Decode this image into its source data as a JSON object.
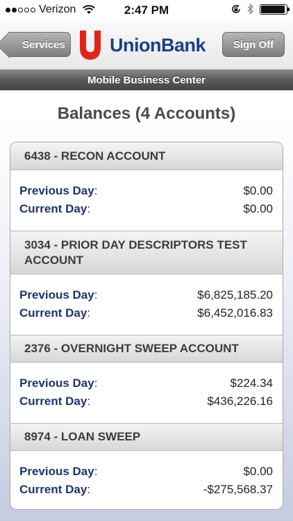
{
  "status_bar": {
    "carrier": "Verizon",
    "signal_filled": 2,
    "signal_total": 5,
    "time": "2:47 PM",
    "battery_level": 0.95,
    "icons": [
      "wifi-icon",
      "rotation-lock-icon",
      "bluetooth-icon",
      "battery-icon"
    ]
  },
  "header": {
    "back_label": "Services",
    "logo_text": "UnionBank",
    "signoff_label": "Sign Off",
    "brand_color": "#1d3e88",
    "logo_color": "#e2231a"
  },
  "subheader": {
    "title": "Mobile Business Center"
  },
  "page": {
    "title": "Balances (4 Accounts)"
  },
  "accounts": [
    {
      "name": "6438 - RECON ACCOUNT",
      "previous_label": "Previous Day",
      "previous_value": "$0.00",
      "current_label": "Current Day",
      "current_value": "$0.00"
    },
    {
      "name": "3034 - PRIOR DAY DESCRIPTORS TEST ACCOUNT",
      "previous_label": "Previous Day",
      "previous_value": "$6,825,185.20",
      "current_label": "Current Day",
      "current_value": "$6,452,016.83"
    },
    {
      "name": "2376 - OVERNIGHT SWEEP ACCOUNT",
      "previous_label": "Previous Day",
      "previous_value": "$224.34",
      "current_label": "Current Day",
      "current_value": "$436,226.16"
    },
    {
      "name": "8974 - LOAN SWEEP",
      "previous_label": "Previous Day",
      "previous_value": "$0.00",
      "current_label": "Current Day",
      "current_value": "-$275,568.37"
    }
  ]
}
